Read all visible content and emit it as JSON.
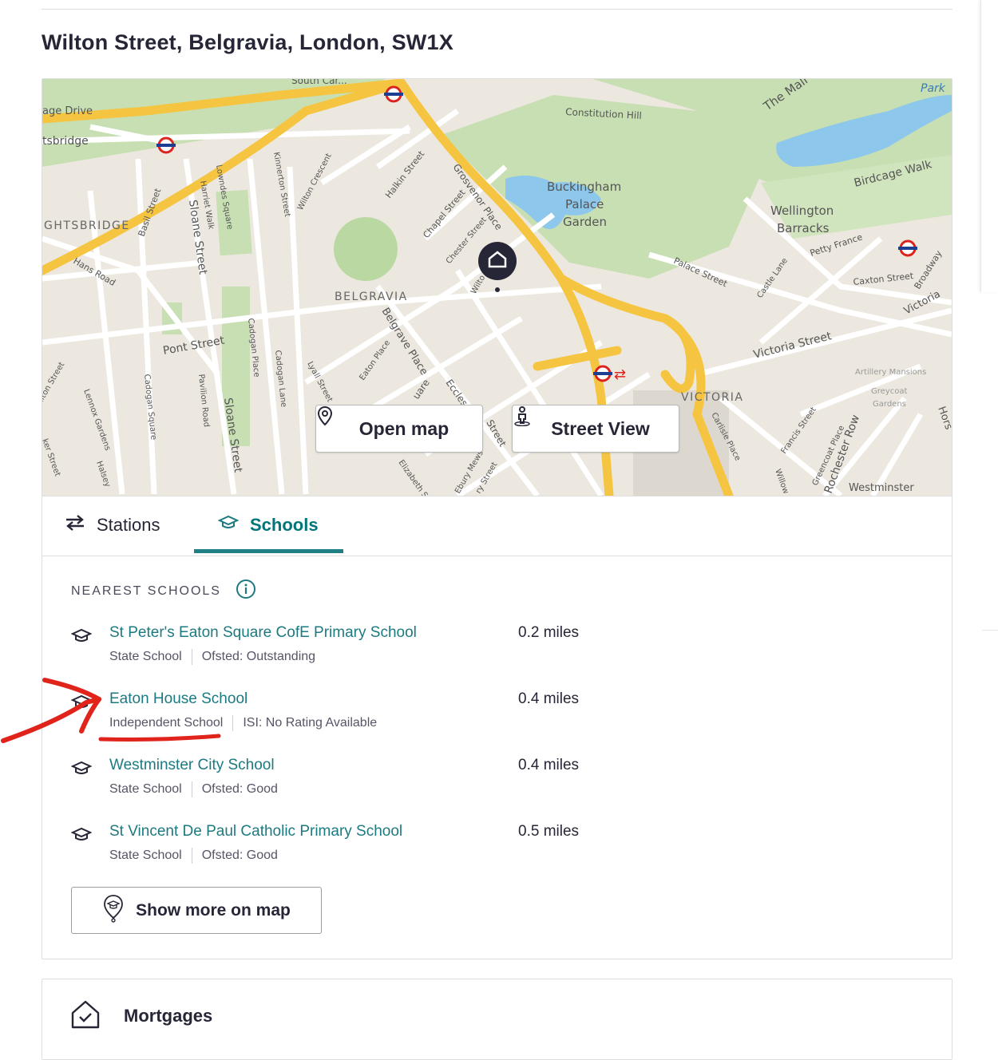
{
  "address": "Wilton Street, Belgravia, London, SW1X",
  "map": {
    "labels": {
      "south_carriage": "South Car...",
      "carriage_drive": "age Drive",
      "knightsbridge_st": "tsbridge",
      "knightsbridge_area": "GHTSBRIDGE",
      "constitution_hill": "Constitution Hill",
      "the_mall": "The Mall",
      "park": "Park",
      "birdcage_walk": "Birdcage Walk",
      "buckingham": "Buckingham",
      "palace": "Palace",
      "garden": "Garden",
      "wellington": "Wellington",
      "barracks": "Barracks",
      "petty_france": "Petty France",
      "caxton_street": "Caxton Street",
      "broadway": "Broadway",
      "belgravia": "BELGRAVIA",
      "victoria_area": "VICTORIA",
      "victoria_street": "Victoria Street",
      "victoria_road": "Victoria",
      "pont_street": "Pont Street",
      "sloane_street": "Sloane Street",
      "sloane_street_2": "Sloane Street",
      "hans_road": "Hans Road",
      "basil_street": "Basil Street",
      "grosvenor_place": "Grosvenor Place",
      "chapel_street": "Chapel Street",
      "halkin_street": "Halkin Street",
      "chester_street": "Chester Street",
      "wilton_crescent": "Wilton Crescent",
      "kinnerton_street": "Kinnerton Street",
      "lowndes_square": "Lowndes Square",
      "harriet_walk": "Harriet Walk",
      "belgrave_place": "Belgrave Place",
      "eaton_place": "Eaton Place",
      "lyall_street": "Lyall Street",
      "cadogan_place": "Cadogan Place",
      "cadogan_lane": "Cadogan Lane",
      "cadogan_square": "Cadogan Square",
      "pavilion_road": "Pavilion Road",
      "palace_street": "Palace Street",
      "castle_lane": "Castle Lane",
      "carlisle_place": "Carlisle Place",
      "francis_street": "Francis Street",
      "greencoat_place": "Greencoat Place",
      "rochester_row": "Rochester Row",
      "westminster": "Westminster",
      "artillery": "Artillery Mansions",
      "greycoat": "Greycoat",
      "gardens": "Gardens",
      "ebury_mews": "Ebury Mews",
      "elizabeth_street": "Elizabeth Str",
      "wilton_pin": "Wilto",
      "square": "uare",
      "eccles": "Eccles",
      "street_frag": "Street",
      "lennox_gardens": "Lennox Gardens",
      "halsey": "Halsey",
      "ilton_street": "ilton Street",
      "ker_street": "ker Street",
      "willow": "Willow",
      "horse": "Hors",
      "ry_street": "ry Street"
    },
    "buttons": {
      "open_map": "Open map",
      "street_view": "Street View"
    }
  },
  "tabs": [
    {
      "label": "Stations",
      "active": false
    },
    {
      "label": "Schools",
      "active": true
    }
  ],
  "schools_section": {
    "title": "NEAREST SCHOOLS",
    "items": [
      {
        "name": "St Peter's Eaton Square CofE Primary School",
        "distance": "0.2 miles",
        "type": "State School",
        "rating": "Ofsted: Outstanding"
      },
      {
        "name": "Eaton House School",
        "distance": "0.4 miles",
        "type": "Independent School",
        "rating": "ISI: No Rating Available"
      },
      {
        "name": "Westminster City School",
        "distance": "0.4 miles",
        "type": "State School",
        "rating": "Ofsted: Good"
      },
      {
        "name": "St Vincent De Paul Catholic Primary School",
        "distance": "0.5 miles",
        "type": "State School",
        "rating": "Ofsted: Good"
      }
    ],
    "show_more": "Show more on map"
  },
  "mortgages": {
    "title": "Mortgages"
  },
  "colors": {
    "accent": "#1f7f84",
    "link": "#1c7a80",
    "text": "#262637",
    "annotation": "#e0241b",
    "map_road_major": "#f5c542",
    "map_park": "#c7dfb2",
    "map_water": "#8dc7ec"
  },
  "icons": {
    "stations_tab": "train-arrows-icon",
    "schools_tab": "graduation-cap-icon",
    "info": "info-icon",
    "open_map": "map-pin-icon",
    "street_view": "person-icon",
    "show_more": "school-pin-icon",
    "mortgages": "house-check-icon"
  }
}
